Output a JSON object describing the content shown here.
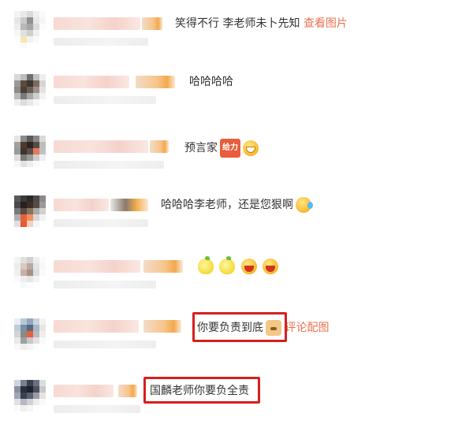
{
  "comments": [
    {
      "text": "笑得不行 李老师未卜先知",
      "link": "查看图片"
    },
    {
      "text": "哈哈哈哈"
    },
    {
      "text": "预言家",
      "sticker": "给力",
      "emoji": "grin"
    },
    {
      "text": "哈哈哈李老师，还是您狠啊",
      "emoji": "tear"
    },
    {
      "emojis": [
        "lemon",
        "lemon",
        "laugh",
        "laugh"
      ]
    },
    {
      "text": "你要负责到底",
      "emoji": "doge",
      "link": "评论配图",
      "highlighted": true
    },
    {
      "text": "国麟老师你要负全责",
      "highlighted": true
    }
  ],
  "colors": {
    "link": "#eb7350",
    "highlight_box": "#d61f1f",
    "text": "#333333"
  }
}
